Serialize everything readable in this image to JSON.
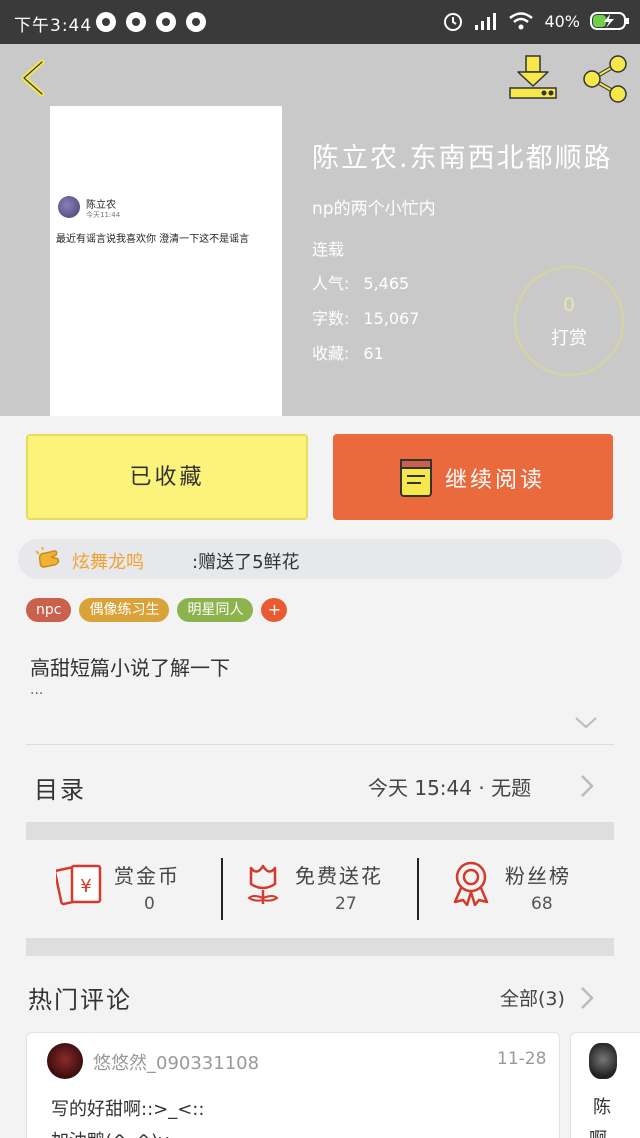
{
  "status_bar": {
    "time": "下午3:44",
    "battery": "40%"
  },
  "book": {
    "title": "陈立农.东南西北都顺路",
    "author": "np的两个小忙内",
    "status": "连载",
    "stats": [
      {
        "label": "人气:",
        "value": "5,465"
      },
      {
        "label": "字数:",
        "value": "15,067"
      },
      {
        "label": "收藏:",
        "value": "61"
      }
    ],
    "reward_count": "0",
    "reward_label": "打赏"
  },
  "cover": {
    "name": "陈立农",
    "time": "今天11:44",
    "message": "最近有谣言说我喜欢你 澄清一下这不是谣言"
  },
  "buttons": {
    "collected": "已收藏",
    "continue": "继续阅读"
  },
  "gift": {
    "user": "炫舞龙鸣",
    "message": ":赠送了5鲜花"
  },
  "tags": [
    {
      "label": "npc",
      "color": "#c9614c"
    },
    {
      "label": "偶像练习生",
      "color": "#d9a33a"
    },
    {
      "label": "明星同人",
      "color": "#8db34f"
    }
  ],
  "tag_add": "+",
  "description": {
    "text": "高甜短篇小说了解一下",
    "more": "..."
  },
  "toc": {
    "label": "目录",
    "latest": "今天 15:44 · 无题"
  },
  "actions": [
    {
      "label": "赏金币",
      "value": "0",
      "icon": "red-envelope-icon"
    },
    {
      "label": "免费送花",
      "value": "27",
      "icon": "flower-icon"
    },
    {
      "label": "粉丝榜",
      "value": "68",
      "icon": "ribbon-medal-icon"
    }
  ],
  "hot_comments": {
    "title": "热门评论",
    "all_label": "全部(3)",
    "items": [
      {
        "user": "悠悠然_090331108",
        "date": "11-28",
        "text": "写的好甜啊::>_<::",
        "text2": "加油鸭(^_^)v"
      },
      {
        "user": "",
        "date": "",
        "text": "陈",
        "text2": "啊"
      }
    ]
  },
  "colors": {
    "header_bg": "#c9c9c9",
    "accent_yellow": "#fcf37a",
    "accent_orange": "#ea6a3d",
    "icon_yellow": "#f6e74a",
    "icon_red": "#d33a2c"
  }
}
